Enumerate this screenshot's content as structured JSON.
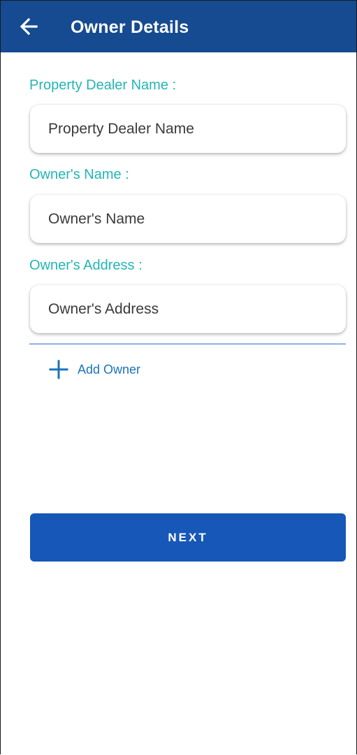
{
  "app_bar": {
    "title": "Owner Details",
    "back_icon": "arrow-left-icon",
    "background": "#164b91"
  },
  "form": {
    "dealer": {
      "label": "Property Dealer Name :",
      "placeholder": "Property Dealer Name",
      "value": ""
    },
    "owner_name": {
      "label": "Owner's Name :",
      "placeholder": "Owner's Name",
      "value": ""
    },
    "owner_address": {
      "label": "Owner's Address :",
      "placeholder": "Owner's Address",
      "value": ""
    }
  },
  "add_owner": {
    "label": "Add Owner",
    "icon": "plus-icon"
  },
  "next_button": {
    "label": "NEXT"
  },
  "colors": {
    "label": "#23b5b5",
    "primary": "#1757b7",
    "link": "#1a73b8"
  }
}
